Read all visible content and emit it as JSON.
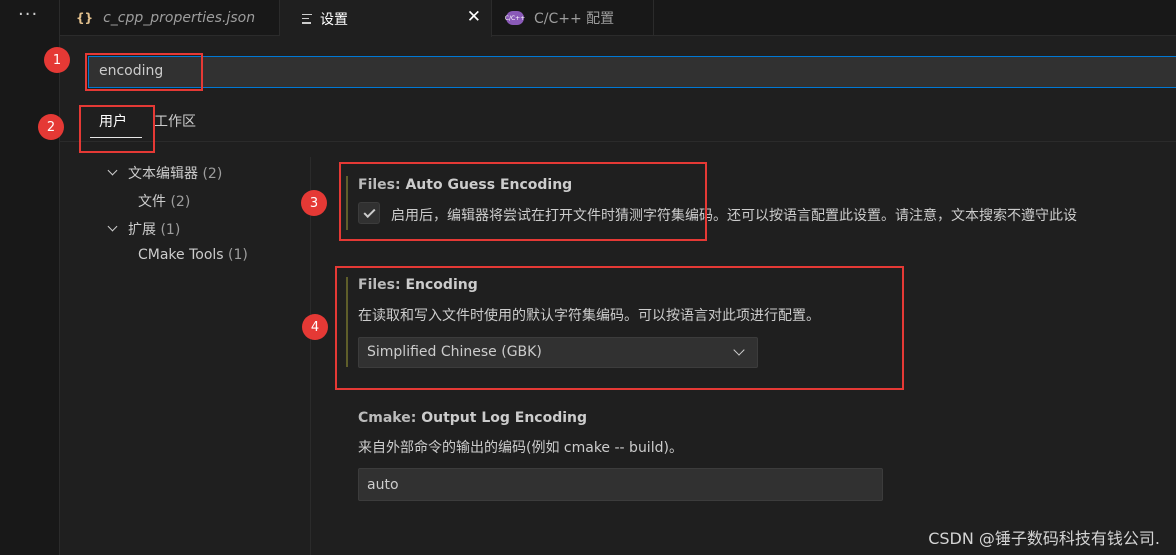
{
  "activity_bar": {
    "more_icon": "···"
  },
  "tabs": [
    {
      "icon": "{}",
      "label": "c_cpp_properties.json"
    },
    {
      "icon": "lines-icon",
      "label": "设置",
      "close": "✕"
    },
    {
      "icon": "C/C++",
      "label": "C/C++ 配置"
    }
  ],
  "search": {
    "value": "encoding"
  },
  "scopes": {
    "user": "用户",
    "workspace": "工作区"
  },
  "toc": [
    {
      "label": "文本编辑器",
      "count": "(2)"
    },
    {
      "label": "文件",
      "count": "(2)"
    },
    {
      "label": "扩展",
      "count": "(1)"
    },
    {
      "label": "CMake Tools",
      "count": "(1)"
    }
  ],
  "settings": [
    {
      "category": "Files: ",
      "name": "Auto Guess Encoding",
      "description": "启用后，编辑器将尝试在打开文件时猜测字符集编码。还可以按语言配置此设置。请注意，文本搜索不遵守此设"
    },
    {
      "category": "Files: ",
      "name": "Encoding",
      "description": "在读取和写入文件时使用的默认字符集编码。可以按语言对此项进行配置。",
      "value": "Simplified Chinese (GBK)"
    },
    {
      "category": "Cmake: ",
      "name": "Output Log Encoding",
      "description": "来自外部命令的输出的编码(例如 cmake -- build)。",
      "value": "auto"
    }
  ],
  "annotations": [
    "1",
    "2",
    "3",
    "4"
  ],
  "watermark": "CSDN @锤子数码科技有钱公司."
}
